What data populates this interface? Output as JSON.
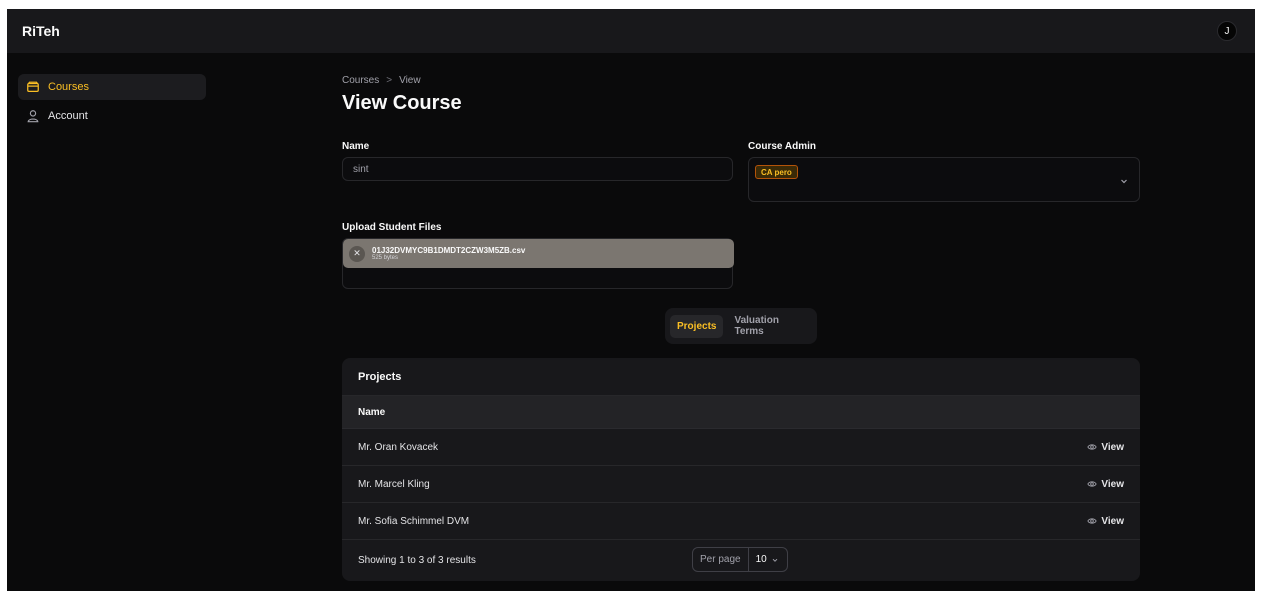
{
  "app": {
    "brand": "RiTeh",
    "user_initial": "J"
  },
  "sidebar": {
    "items": [
      {
        "label": "Courses",
        "icon": "folder-icon",
        "active": true
      },
      {
        "label": "Account",
        "icon": "user-icon",
        "active": false
      }
    ]
  },
  "breadcrumb": {
    "items": [
      "Courses",
      "View"
    ]
  },
  "page": {
    "title": "View Course"
  },
  "form": {
    "name_label": "Name",
    "name_value": "sint",
    "admin_label": "Course Admin",
    "admin_chip": "CA pero",
    "upload_label": "Upload Student Files",
    "file_name": "01J32DVMYC9B1DMDT2CZW3M5ZB.csv",
    "file_size": "525 bytes"
  },
  "tabs": [
    {
      "label": "Projects",
      "active": true
    },
    {
      "label": "Valuation Terms",
      "active": false
    }
  ],
  "projects": {
    "title": "Projects",
    "column_name": "Name",
    "view_label": "View",
    "rows": [
      {
        "name": "Mr. Oran Kovacek"
      },
      {
        "name": "Mr. Marcel Kling"
      },
      {
        "name": "Mr. Sofia Schimmel DVM"
      }
    ],
    "summary": "Showing 1 to 3 of 3 results",
    "per_page_label": "Per page",
    "per_page_value": "10"
  },
  "colors": {
    "accent": "#fbbf24",
    "background": "#0a0a0b",
    "surface": "#18181b"
  }
}
